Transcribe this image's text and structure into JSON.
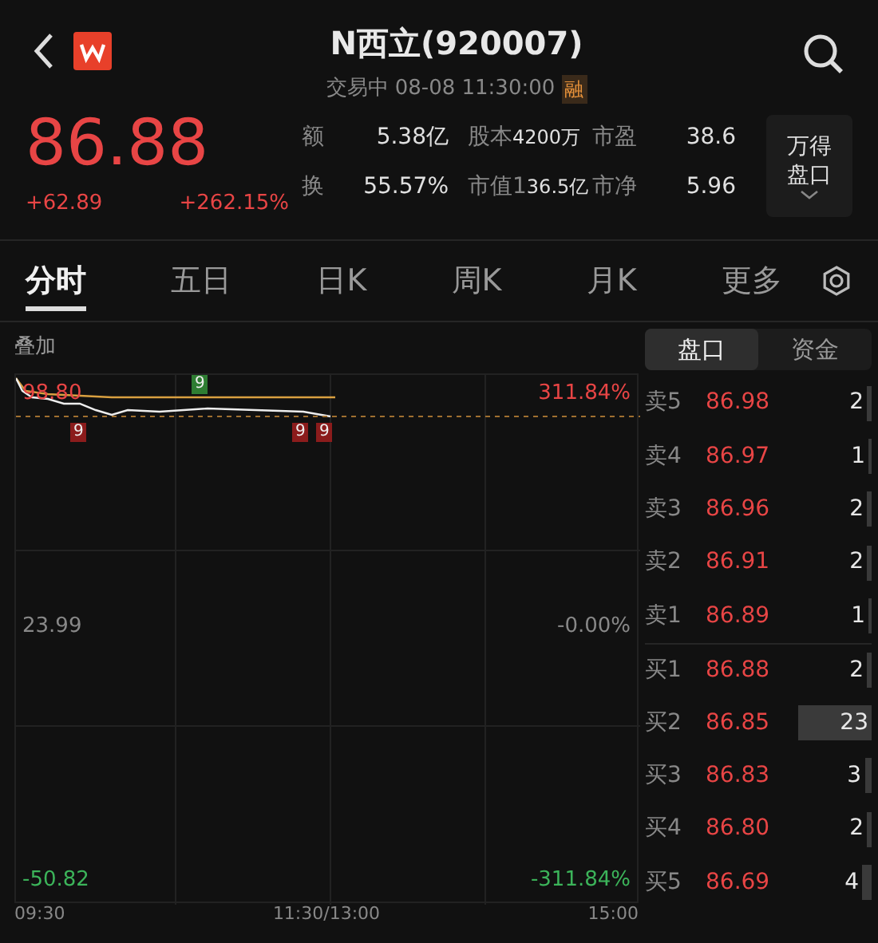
{
  "header": {
    "title": "N西立(920007)",
    "status": "交易中",
    "datetime": "08-08 11:30:00",
    "margin_badge": "融"
  },
  "quote": {
    "price": "86.88",
    "change": "+62.89",
    "change_pct": "+262.15%",
    "stats": [
      {
        "label": "额",
        "value": "5.38亿"
      },
      {
        "label": "股本",
        "value": "4200万"
      },
      {
        "label": "市盈",
        "value": "38.6"
      },
      {
        "label": "换",
        "value": "55.57%"
      },
      {
        "label": "市值1",
        "value": "36.5亿"
      },
      {
        "label": "市净",
        "value": "5.96"
      }
    ],
    "side_button": {
      "lines": [
        "万得",
        "盘口"
      ]
    }
  },
  "tabs": [
    {
      "label": "分时",
      "selected": true
    },
    {
      "label": "五日",
      "selected": false
    },
    {
      "label": "日K",
      "selected": false
    },
    {
      "label": "周K",
      "selected": false
    },
    {
      "label": "月K",
      "selected": false
    },
    {
      "label": "更多",
      "selected": false
    }
  ],
  "overlay_label": "叠加",
  "panel_tabs": [
    {
      "label": "盘口",
      "selected": true
    },
    {
      "label": "资金",
      "selected": false
    }
  ],
  "chart": {
    "price_high": "98.80",
    "pct_high": "311.84%",
    "price_mid": "23.99",
    "pct_mid": "-0.00%",
    "price_low": "-50.82",
    "pct_low": "-311.84%",
    "times": [
      "09:30",
      "11:30/13:00",
      "15:00"
    ],
    "markers": [
      {
        "text": "9",
        "color": "#2e7d32"
      },
      {
        "text": "9",
        "color": "#8b1c1c"
      },
      {
        "text": "9",
        "color": "#8b1c1c"
      },
      {
        "text": "9",
        "color": "#8b1c1c"
      }
    ]
  },
  "order_book": [
    {
      "label": "卖5",
      "price": "86.98",
      "volume": "2"
    },
    {
      "label": "卖4",
      "price": "86.97",
      "volume": "1"
    },
    {
      "label": "卖3",
      "price": "86.96",
      "volume": "2"
    },
    {
      "label": "卖2",
      "price": "86.91",
      "volume": "2"
    },
    {
      "label": "卖1",
      "price": "86.89",
      "volume": "1"
    },
    {
      "label": "买1",
      "price": "86.88",
      "volume": "2"
    },
    {
      "label": "买2",
      "price": "86.85",
      "volume": "23"
    },
    {
      "label": "买3",
      "price": "86.83",
      "volume": "3"
    },
    {
      "label": "买4",
      "price": "86.80",
      "volume": "2"
    },
    {
      "label": "买5",
      "price": "86.69",
      "volume": "4"
    }
  ]
}
